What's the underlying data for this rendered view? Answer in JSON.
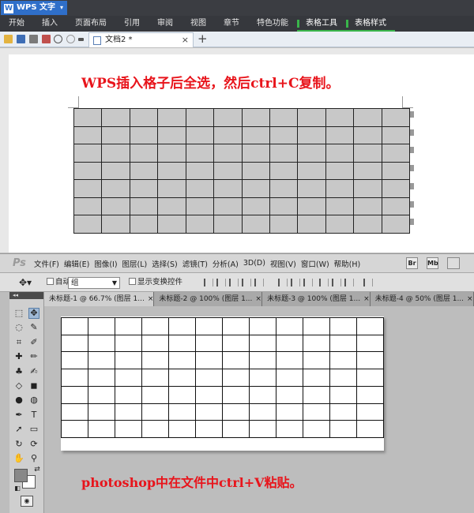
{
  "wps": {
    "app_name": "WPS 文字",
    "logo_letter": "W",
    "dropdown_glyph": "▾",
    "menu": [
      "开始",
      "插入",
      "页面布局",
      "引用",
      "审阅",
      "视图",
      "章节",
      "特色功能",
      "表格工具",
      "表格样式"
    ],
    "document_tab": "文档2 *",
    "close_glyph": "×",
    "new_tab_glyph": "+",
    "caption": "WPS插入格子后全选，然后ctrl+C复制。",
    "table": {
      "rows": 7,
      "cols": 12,
      "fill_color": "#c8c8c8"
    },
    "colors": {
      "title_bar": "#3b3d42",
      "app_button": "#2f6fc9",
      "active_ribbon_accent": "#39b54a",
      "caption": "#e8141b"
    }
  },
  "ps": {
    "logo": "Ps",
    "menu": [
      "文件(F)",
      "编辑(E)",
      "图像(I)",
      "图层(L)",
      "选择(S)",
      "滤镜(T)",
      "分析(A)",
      "3D(D)",
      "视图(V)",
      "窗口(W)",
      "帮助(H)"
    ],
    "bridge_labels": [
      "Br",
      "Mb"
    ],
    "options": {
      "auto_select_label": "自动选择:",
      "auto_select_value": "组",
      "transform_label": "显示变换控件"
    },
    "document_tabs": [
      "未标题-1 @ 66.7% (图层 1...",
      "未标题-2 @ 100% (图层 1...",
      "未标题-3 @ 100% (图层 1...",
      "未标题-4 @ 50% (图层 1..."
    ],
    "canvas_table": {
      "rows": 7,
      "cols": 12
    },
    "caption": "photoshop中在文件中ctrl+V粘贴。",
    "icons": [
      "marquee-icon",
      "move-icon",
      "lasso-icon",
      "quick-select-icon",
      "crop-icon",
      "eyedropper-icon",
      "healing-brush-icon",
      "brush-icon",
      "stamp-icon",
      "history-brush-icon",
      "eraser-icon",
      "gradient-icon",
      "blur-icon",
      "dodge-icon",
      "pen-icon",
      "type-icon",
      "path-select-icon",
      "shape-icon",
      "3d-rotate-icon",
      "3d-orbit-icon",
      "hand-icon",
      "zoom-icon"
    ]
  }
}
